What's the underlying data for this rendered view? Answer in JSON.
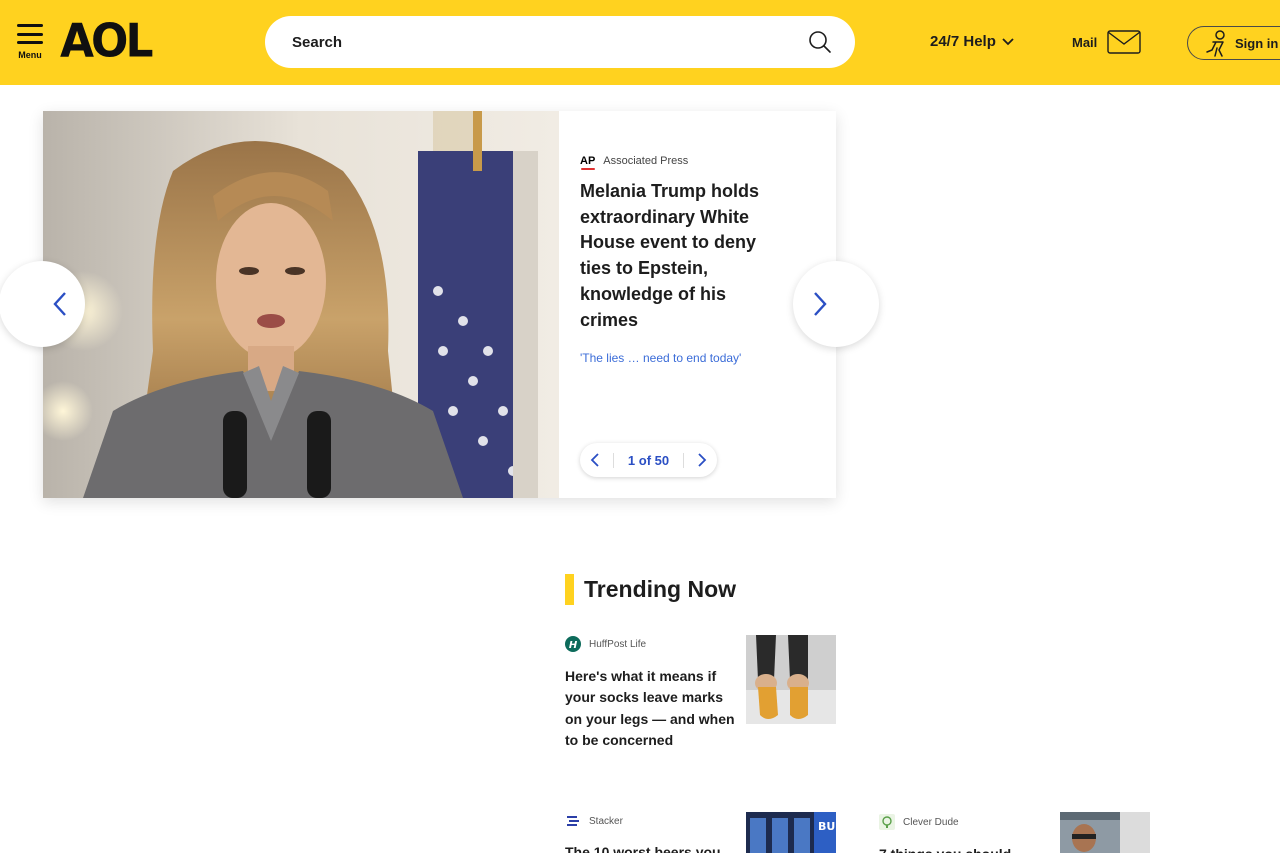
{
  "header": {
    "menu_label": "Menu",
    "logo_text": "AOL",
    "search_placeholder": "Search",
    "help_label": "24/7 Help",
    "mail_label": "Mail",
    "signin_label": "Sign in",
    "accent_color": "#ffd21f"
  },
  "hero": {
    "source": "Associated Press",
    "source_logo": "AP",
    "headline": "Melania Trump holds extraordinary White House event to deny ties to Epstein, knowledge of his crimes",
    "summary": "'The lies … need to end today'",
    "pager": "1 of 50"
  },
  "trending": {
    "title": "Trending Now",
    "stories": [
      {
        "source": "HuffPost Life",
        "title": "Here's what it means if your socks leave marks on your legs — and when to be concerned"
      },
      {
        "source": "Stacker",
        "title": "The 10 worst beers you"
      },
      {
        "source": "Clever Dude",
        "title": "7 things you should"
      }
    ]
  }
}
